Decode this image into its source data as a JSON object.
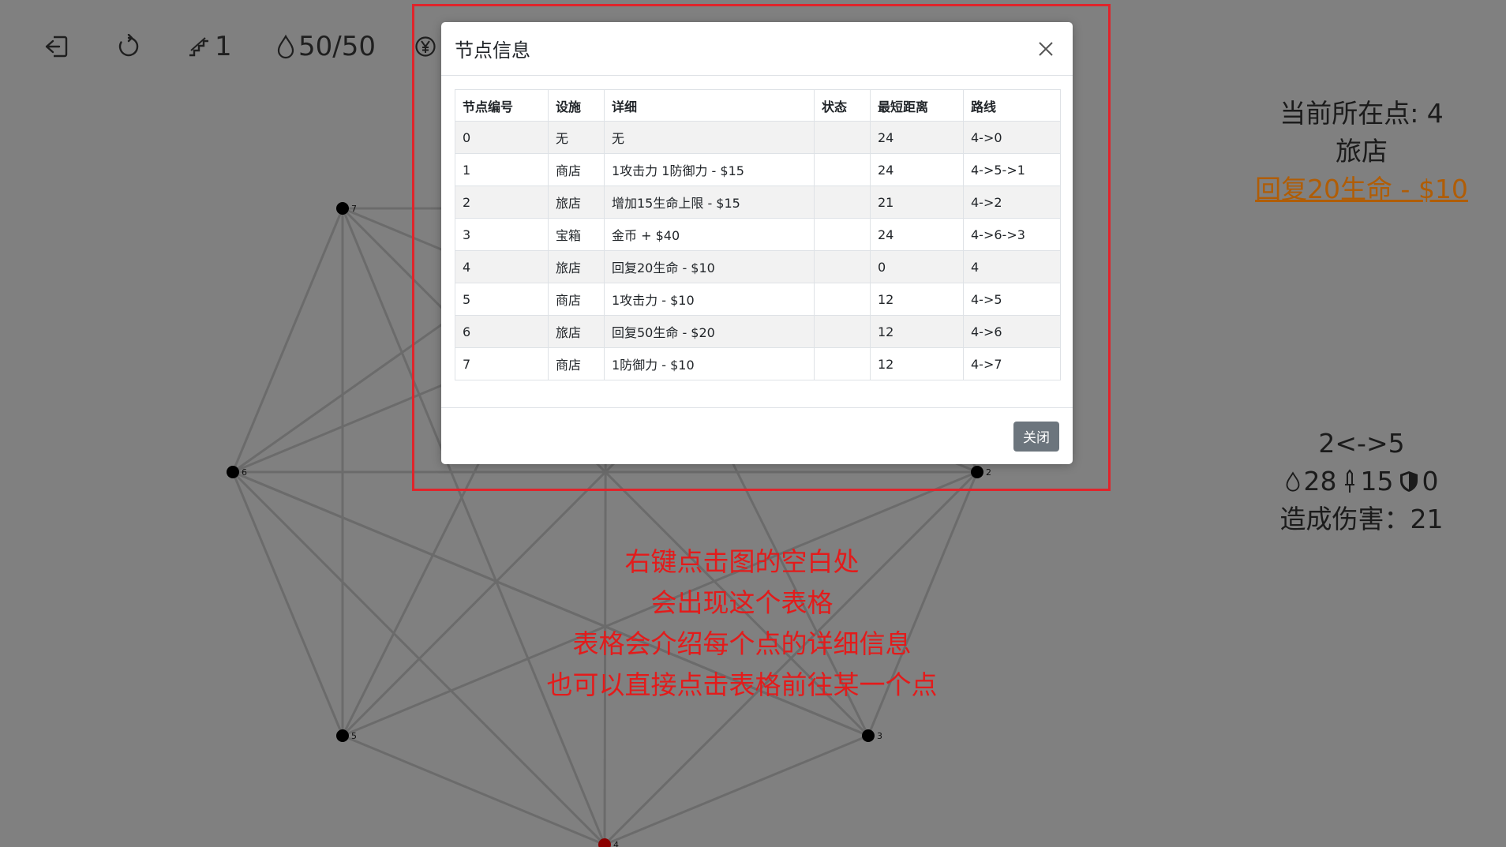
{
  "toolbar": {
    "floor": "1",
    "hp": "50/50"
  },
  "current": {
    "label": "当前所在点: 4",
    "facility": "旅店",
    "action": "回复20生命 - $10"
  },
  "edge_info": {
    "edge": "2<->5",
    "hp": "28",
    "attack": "15",
    "defense": "0",
    "damage": "造成伤害：21"
  },
  "annotation": {
    "line1": "右键点击图的空白处",
    "line2": "会出现这个表格",
    "line3": "表格会介绍每个点的详细信息",
    "line4": "也可以直接点击表格前往某一个点"
  },
  "modal": {
    "title": "节点信息",
    "close_label": "关闭",
    "columns": [
      "节点编号",
      "设施",
      "详细",
      "状态",
      "最短距离",
      "路线"
    ],
    "rows": [
      [
        "0",
        "无",
        "无",
        "",
        "24",
        "4->0"
      ],
      [
        "1",
        "商店",
        "1攻击力 1防御力 - $15",
        "",
        "24",
        "4->5->1"
      ],
      [
        "2",
        "旅店",
        "增加15生命上限 - $15",
        "",
        "21",
        "4->2"
      ],
      [
        "3",
        "宝箱",
        "金币 + $40",
        "",
        "24",
        "4->6->3"
      ],
      [
        "4",
        "旅店",
        "回复20生命 - $10",
        "",
        "0",
        "4"
      ],
      [
        "5",
        "商店",
        "1攻击力 - $10",
        "",
        "12",
        "4->5"
      ],
      [
        "6",
        "旅店",
        "回复50生命 - $20",
        "",
        "12",
        "4->6"
      ],
      [
        "7",
        "商店",
        "1防御力 - $10",
        "",
        "12",
        "4->7"
      ]
    ]
  },
  "graph": {
    "current_node": "4",
    "node_color": "#000000",
    "current_node_color": "#8b0000",
    "edge_color": "#6b6b6b",
    "nodes": [
      "7",
      "6",
      "2",
      "5",
      "3",
      "4"
    ]
  }
}
